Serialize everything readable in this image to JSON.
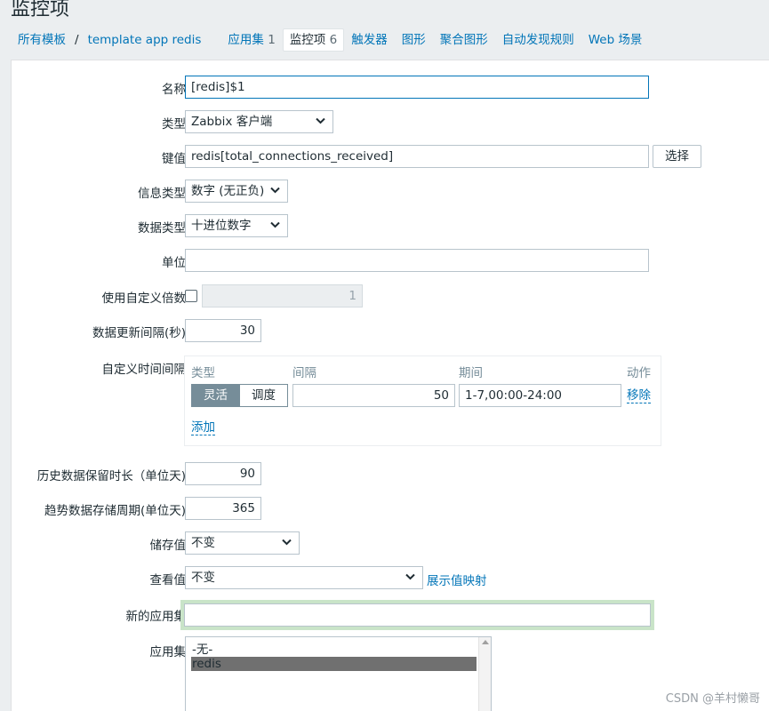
{
  "page": {
    "title": "监控项"
  },
  "nav": {
    "all_templates": "所有模板",
    "separator": "/",
    "template": "template app redis",
    "applications": "应用集",
    "applications_count": "1",
    "items": "监控项",
    "items_count": "6",
    "triggers": "触发器",
    "graphs": "图形",
    "screens": "聚合图形",
    "discovery": "自动发现规则",
    "web": "Web 场景"
  },
  "form": {
    "name": {
      "label": "名称",
      "value": "[redis]$1"
    },
    "type": {
      "label": "类型",
      "value": "Zabbix 客户端"
    },
    "key": {
      "label": "键值",
      "value": "redis[total_connections_received]",
      "select_button": "选择"
    },
    "info_type": {
      "label": "信息类型",
      "value": "数字 (无正负)"
    },
    "data_type": {
      "label": "数据类型",
      "value": "十进位数字"
    },
    "units": {
      "label": "单位",
      "value": ""
    },
    "multiplier": {
      "label": "使用自定义倍数",
      "checked": false,
      "value": "1"
    },
    "update_interval": {
      "label": "数据更新间隔(秒)",
      "value": "30"
    },
    "custom_intervals": {
      "label": "自定义时间间隔",
      "headers": {
        "type": "类型",
        "interval": "间隔",
        "period": "期间",
        "action": "动作"
      },
      "rows": [
        {
          "type_flexible": "灵活",
          "type_scheduling": "调度",
          "interval": "50",
          "period": "1-7,00:00-24:00",
          "remove": "移除"
        }
      ],
      "add": "添加"
    },
    "history": {
      "label": "历史数据保留时长（单位天)",
      "value": "90"
    },
    "trends": {
      "label": "趋势数据存储周期(单位天)",
      "value": "365"
    },
    "store_value": {
      "label": "储存值",
      "value": "不变"
    },
    "show_value": {
      "label": "查看值",
      "value": "不变",
      "mapping_link": "展示值映射"
    },
    "new_application": {
      "label": "新的应用集",
      "value": ""
    },
    "applications": {
      "label": "应用集",
      "options": [
        "-无-",
        "redis"
      ],
      "selected": "redis"
    }
  },
  "watermark": "CSDN @羊村懒哥",
  "colors": {
    "link": "#0275b8",
    "background": "#ebeef0",
    "segment_active": "#768d99",
    "focus_glow": "#c9e4c8"
  }
}
